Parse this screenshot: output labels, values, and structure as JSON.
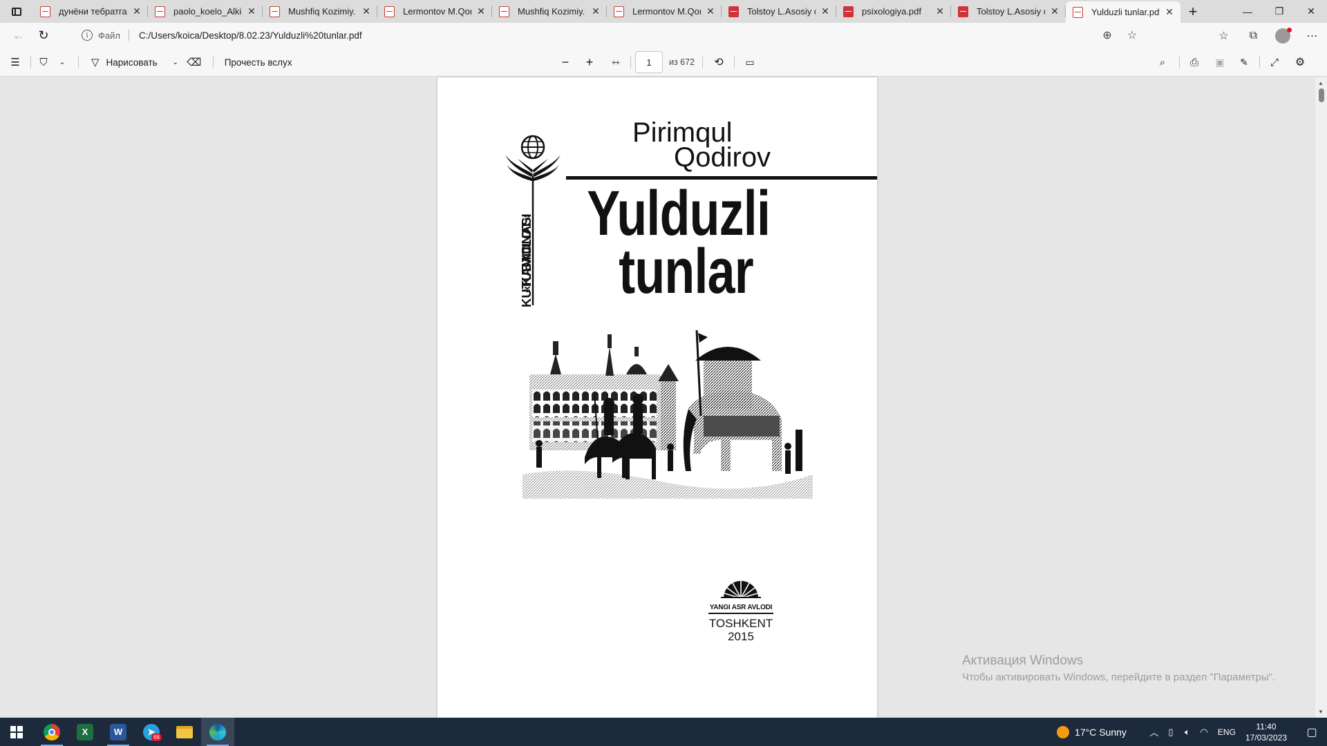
{
  "tabs": [
    {
      "label": "дунёни тебратган",
      "active": false
    },
    {
      "label": "paolo_koelo_Alkim",
      "active": false
    },
    {
      "label": "Mushfiq Kozimiy. C",
      "active": false
    },
    {
      "label": "Lermontov M.Qora",
      "active": false
    },
    {
      "label": "Mushfiq Kozimiy. C",
      "active": false
    },
    {
      "label": "Lermontov M.Qora",
      "active": false
    },
    {
      "label": "Tolstoy L.Asosiy qa",
      "active": false
    },
    {
      "label": "psixologiya.pdf",
      "active": false
    },
    {
      "label": "Tolstoy L.Asosiy qa",
      "active": false
    },
    {
      "label": "Yulduzli tunlar.pdf",
      "active": true
    }
  ],
  "address": {
    "protocol": "Файл",
    "url": "C:/Users/koica/Desktop/8.02.23/Yulduzli%20tunlar.pdf"
  },
  "pdf_toolbar": {
    "draw_label": "Нарисовать",
    "read_aloud_label": "Прочесть вслух",
    "page_current": "1",
    "page_total": "из 672"
  },
  "document": {
    "author_line1": "Pirimqul",
    "author_line2": "Qodirov",
    "title_line1": "Yulduzli",
    "title_line2": "tunlar",
    "series_line1": "«KAMOLOT»",
    "series_line2": "KUTUBXONASI",
    "publisher_name": "YANGI ASR AVLODI",
    "city": "TOSHKENT",
    "year": "2015"
  },
  "activation": {
    "heading": "Активация Windows",
    "subtext": "Чтобы активировать Windows, перейдите в раздел \"Параметры\"."
  },
  "taskbar": {
    "apps": [
      "start-icon",
      "chrome-icon",
      "excel-icon",
      "word-icon",
      "telegram-icon",
      "file-explorer-icon",
      "edge-icon"
    ],
    "telegram_badge": "68",
    "weather": "17°C  Sunny",
    "language": "ENG",
    "time": "11:40",
    "date": "17/03/2023"
  },
  "colors": {
    "accent": "#0078d4",
    "pdf_icon": "#d13438",
    "taskbar": "#1c2a3c"
  }
}
